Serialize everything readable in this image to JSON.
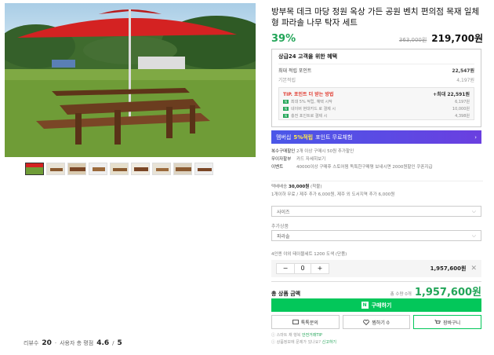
{
  "product": {
    "title": "방부목 데크 마당 정원 옥상 가든 공원 벤치 편의점 목재 일체형 파라솔 나무 탁자 세트",
    "discount": "39%",
    "original_price": "363,000원",
    "price": "219,700원"
  },
  "benefit": {
    "heading": "상급24 고객을 위한 혜택",
    "max_points_label": "최대 적립 포인트",
    "max_points_value": "22,547원",
    "basic_label": "기본적립",
    "basic_value": "4,197원",
    "tip_label": "TIP. 포인트 더 받는 방법",
    "tip_value": "+최대 22,591원",
    "tip_rows": [
      {
        "tag": "N",
        "label": "최대 5% 적립, 혜택 시작",
        "value": "6,197원"
      },
      {
        "tag": "N",
        "label": "네이버 현대카드 로 결제 시",
        "value": "10,000원"
      },
      {
        "tag": "N",
        "label": "충전 포인트로 결제 시",
        "value": "4,398원"
      }
    ]
  },
  "banner": {
    "prefix": "멤버십",
    "highlight": "5%적립",
    "suffix": "포인트 무료체험",
    "arrow": "›"
  },
  "info": {
    "rows": [
      {
        "k": "복수구매할인",
        "v": "2개 이상 구매시 50원 추가할인"
      },
      {
        "k": "무이자할부",
        "v": "카드 자세히보기"
      },
      {
        "k": "이벤트",
        "v": "40000이상 구매후 스토어찜 독특한구매평 보내시면 2000원할인 쿠폰지급"
      }
    ]
  },
  "shipping": {
    "label": "택배배송",
    "fee": "30,000원",
    "fee_note": "(착불)",
    "detail": "1개이하 무료 / 제주 추가 6,000원, 제주 외 도서지역 추가 6,000원"
  },
  "options": {
    "size_placeholder": "사이즈",
    "extra_label": "추가상품",
    "extra_value": "파라솔",
    "chev": "⌵",
    "selected_line": "4인엔 야외 테이블세트 1200 도색 (단품)"
  },
  "qty": {
    "minus": "−",
    "value": "0",
    "plus": "+",
    "price": "1,957,600원",
    "remove": "✕"
  },
  "total": {
    "label": "총 상품 금액",
    "count": "총 수량 0개",
    "value": "1,957,600원"
  },
  "buy": {
    "logo": "N",
    "label": "구매하기"
  },
  "buttons": {
    "inquiry": "톡톡문의",
    "wish": "찜하기 0",
    "cart": "장바구니"
  },
  "notes": {
    "line1_prefix": "스마트 채 행복",
    "line1_link": "안전거래TIP",
    "line2_prefix": "상품정보에 문제가 있나요?",
    "line2_link": "신고하기"
  },
  "rating": {
    "review_label": "리뷰수",
    "review_count": "20",
    "score_label": "사용자 총 평점",
    "score": "4.6",
    "score_max": "5"
  },
  "colors": {
    "accent": "#03c75a",
    "discount": "#22a558",
    "banner_start": "#4a57e8",
    "banner_end": "#6a3fe0",
    "tip": "#e03c31"
  }
}
